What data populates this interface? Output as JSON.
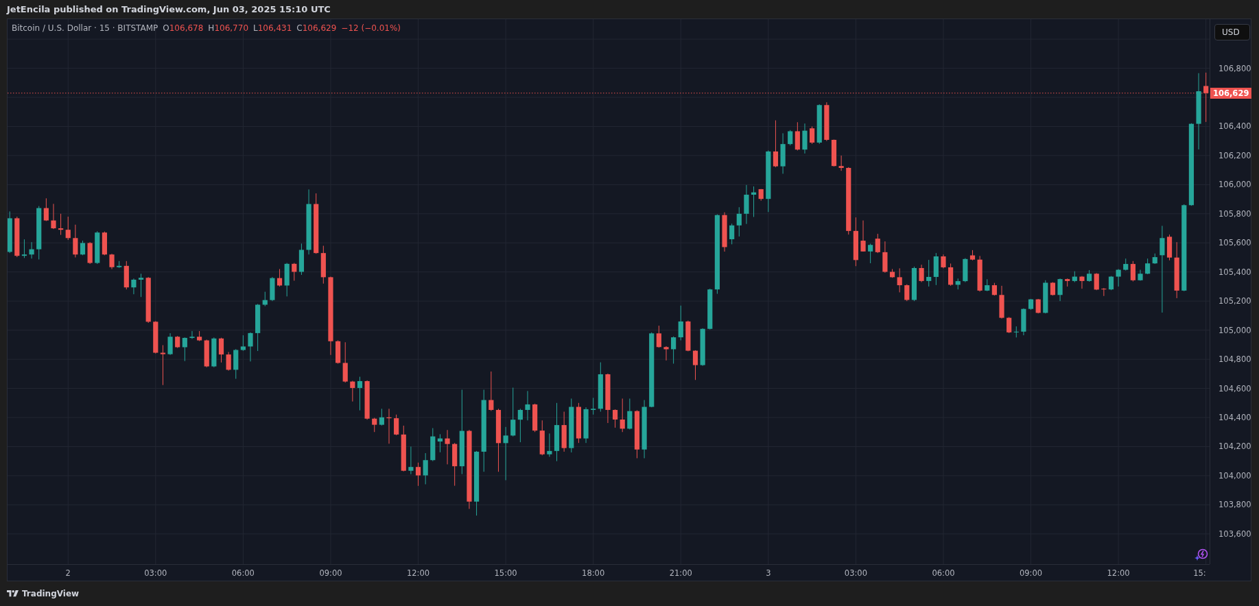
{
  "header": {
    "text": "JetEncila published on TradingView.com, Jun 03, 2025 15:10 UTC"
  },
  "chart": {
    "currency": "USD",
    "legend": {
      "symbol": "Bitcoin / U.S. Dollar · 15 · BITSTAMP",
      "ohlc": [
        {
          "label": "O",
          "value": "106,678"
        },
        {
          "label": "H",
          "value": "106,770"
        },
        {
          "label": "L",
          "value": "106,431"
        },
        {
          "label": "C",
          "value": "106,629"
        }
      ],
      "change": "−12 (−0.01%)"
    },
    "cut_time_label": "15:",
    "chart_data": {
      "type": "candlestick",
      "ylim": [
        103392,
        107137
      ],
      "grid": true,
      "ref_lines": [
        {
          "axis": "y",
          "value": 106629,
          "label": "106,629"
        }
      ],
      "yticks": [
        {
          "value": 103600,
          "label": "103,600"
        },
        {
          "value": 103800,
          "label": "103,800"
        },
        {
          "value": 104000,
          "label": "104,000"
        },
        {
          "value": 104200,
          "label": "104,200"
        },
        {
          "value": 104400,
          "label": "104,400"
        },
        {
          "value": 104600,
          "label": "104,600"
        },
        {
          "value": 104800,
          "label": "104,800"
        },
        {
          "value": 105000,
          "label": "105,000"
        },
        {
          "value": 105200,
          "label": "105,200"
        },
        {
          "value": 105400,
          "label": "105,400"
        },
        {
          "value": 105600,
          "label": "105,600"
        },
        {
          "value": 105800,
          "label": "105,800"
        },
        {
          "value": 106000,
          "label": "106,000"
        },
        {
          "value": 106200,
          "label": "106,200"
        },
        {
          "value": 106400,
          "label": "106,400"
        },
        {
          "value": 106800,
          "label": "106,800"
        }
      ],
      "categories": [
        null,
        null,
        null,
        null,
        null,
        null,
        null,
        null,
        "2",
        null,
        null,
        null,
        null,
        null,
        null,
        null,
        null,
        null,
        null,
        null,
        "03:00",
        null,
        null,
        null,
        null,
        null,
        null,
        null,
        null,
        null,
        null,
        null,
        "06:00",
        null,
        null,
        null,
        null,
        null,
        null,
        null,
        null,
        null,
        null,
        null,
        "09:00",
        null,
        null,
        null,
        null,
        null,
        null,
        null,
        null,
        null,
        null,
        null,
        "12:00",
        null,
        null,
        null,
        null,
        null,
        null,
        null,
        null,
        null,
        null,
        null,
        "15:00",
        null,
        null,
        null,
        null,
        null,
        null,
        null,
        null,
        null,
        null,
        null,
        "18:00",
        null,
        null,
        null,
        null,
        null,
        null,
        null,
        null,
        null,
        null,
        null,
        "21:00",
        null,
        null,
        null,
        null,
        null,
        null,
        null,
        null,
        null,
        null,
        null,
        "3",
        null,
        null,
        null,
        null,
        null,
        null,
        null,
        null,
        null,
        null,
        null,
        "03:00",
        null,
        null,
        null,
        null,
        null,
        null,
        null,
        null,
        null,
        null,
        null,
        "06:00",
        null,
        null,
        null,
        null,
        null,
        null,
        null,
        null,
        null,
        null,
        null,
        "09:00",
        null,
        null,
        null,
        null,
        null,
        null,
        null,
        null,
        null,
        null,
        null,
        "12:00",
        null,
        null,
        null,
        null,
        null,
        null,
        null,
        null,
        null,
        null,
        null,
        null
      ],
      "ohlc": [
        [
          105538,
          105816,
          105530,
          105769
        ],
        [
          105769,
          105780,
          105502,
          105511
        ],
        [
          105511,
          105624,
          105496,
          105520
        ],
        [
          105520,
          105605,
          105492,
          105556
        ],
        [
          105556,
          105853,
          105486,
          105839
        ],
        [
          105839,
          105906,
          105750,
          105754
        ],
        [
          105754,
          105868,
          105695,
          105700
        ],
        [
          105700,
          105800,
          105655,
          105690
        ],
        [
          105690,
          105780,
          105620,
          105633
        ],
        [
          105633,
          105725,
          105500,
          105520
        ],
        [
          105520,
          105615,
          105515,
          105599
        ],
        [
          105599,
          105605,
          105455,
          105462
        ],
        [
          105462,
          105680,
          105455,
          105671
        ],
        [
          105671,
          105678,
          105515,
          105520
        ],
        [
          105520,
          105525,
          105420,
          105433
        ],
        [
          105433,
          105475,
          105428,
          105442
        ],
        [
          105442,
          105475,
          105280,
          105294
        ],
        [
          105294,
          105355,
          105247,
          105347
        ],
        [
          105347,
          105388,
          105228,
          105360
        ],
        [
          105360,
          105365,
          105050,
          105058
        ],
        [
          105058,
          105062,
          104840,
          104845
        ],
        [
          104845,
          104897,
          104623,
          104835
        ],
        [
          104835,
          104979,
          104830,
          104955
        ],
        [
          104955,
          104960,
          104878,
          104883
        ],
        [
          104883,
          104950,
          104788,
          104947
        ],
        [
          104947,
          104994,
          104940,
          104955
        ],
        [
          104955,
          104994,
          104925,
          104930
        ],
        [
          104930,
          104935,
          104745,
          104751
        ],
        [
          104751,
          104950,
          104745,
          104943
        ],
        [
          104943,
          104948,
          104778,
          104833
        ],
        [
          104833,
          104850,
          104722,
          104728
        ],
        [
          104728,
          104870,
          104666,
          104864
        ],
        [
          104864,
          104965,
          104858,
          104888
        ],
        [
          104888,
          104985,
          104785,
          104980
        ],
        [
          104980,
          105180,
          104857,
          105175
        ],
        [
          105175,
          105264,
          105165,
          105207
        ],
        [
          105207,
          105365,
          105200,
          105358
        ],
        [
          105358,
          105420,
          105300,
          105307
        ],
        [
          105307,
          105462,
          105232,
          105456
        ],
        [
          105456,
          105462,
          105340,
          105401
        ],
        [
          105401,
          105595,
          105380,
          105552
        ],
        [
          105552,
          105967,
          105520,
          105867
        ],
        [
          105867,
          105940,
          105525,
          105530
        ],
        [
          105530,
          105580,
          105320,
          105364
        ],
        [
          105364,
          105368,
          104830,
          104924
        ],
        [
          104924,
          104930,
          104770,
          104775
        ],
        [
          104775,
          104917,
          104640,
          104647
        ],
        [
          104647,
          104652,
          104510,
          104603
        ],
        [
          104603,
          104680,
          104449,
          104650
        ],
        [
          104650,
          104655,
          104385,
          104392
        ],
        [
          104392,
          104398,
          104300,
          104350
        ],
        [
          104350,
          104460,
          104345,
          104401
        ],
        [
          104401,
          104460,
          104220,
          104395
        ],
        [
          104395,
          104420,
          104278,
          104283
        ],
        [
          104283,
          104344,
          104030,
          104034
        ],
        [
          104034,
          104200,
          104010,
          104060
        ],
        [
          104060,
          104090,
          103930,
          104002
        ],
        [
          104002,
          104155,
          103941,
          104107
        ],
        [
          104107,
          104327,
          104100,
          104270
        ],
        [
          104235,
          104285,
          104161,
          104256
        ],
        [
          104256,
          104314,
          104078,
          104218
        ],
        [
          104218,
          104225,
          103931,
          104065
        ],
        [
          104065,
          104591,
          104011,
          104308
        ],
        [
          104308,
          104315,
          103772,
          103822
        ],
        [
          103822,
          104170,
          103726,
          104165
        ],
        [
          104165,
          104591,
          104027,
          104520
        ],
        [
          104520,
          104716,
          104445,
          104452
        ],
        [
          104452,
          104460,
          104027,
          104224
        ],
        [
          104224,
          104335,
          103969,
          104276
        ],
        [
          104276,
          104605,
          104270,
          104385
        ],
        [
          104385,
          104460,
          104230,
          104452
        ],
        [
          104452,
          104582,
          104380,
          104490
        ],
        [
          104490,
          104495,
          104300,
          104310
        ],
        [
          104310,
          104380,
          104140,
          104147
        ],
        [
          104147,
          104290,
          104130,
          104170
        ],
        [
          104170,
          104500,
          104100,
          104348
        ],
        [
          104348,
          104440,
          104165,
          104190
        ],
        [
          104190,
          104530,
          104160,
          104473
        ],
        [
          104473,
          104500,
          104225,
          104256
        ],
        [
          104256,
          104470,
          104225,
          104457
        ],
        [
          104452,
          104535,
          104420,
          104460
        ],
        [
          104460,
          104779,
          104440,
          104697
        ],
        [
          104697,
          104702,
          104362,
          104452
        ],
        [
          104452,
          104456,
          104330,
          104386
        ],
        [
          104386,
          104530,
          104300,
          104323
        ],
        [
          104323,
          104530,
          104318,
          104444
        ],
        [
          104444,
          104450,
          104120,
          104180
        ],
        [
          104180,
          104520,
          104120,
          104473
        ],
        [
          104473,
          104985,
          104470,
          104978
        ],
        [
          104978,
          105031,
          104880,
          104884
        ],
        [
          104884,
          104890,
          104792,
          104869
        ],
        [
          104869,
          104957,
          104770,
          104951
        ],
        [
          104951,
          105169,
          104930,
          105060
        ],
        [
          105060,
          105066,
          104855,
          104859
        ],
        [
          104859,
          104862,
          104658,
          104760
        ],
        [
          104760,
          105013,
          104755,
          105009
        ],
        [
          105009,
          105285,
          105005,
          105280
        ],
        [
          105280,
          105796,
          105250,
          105791
        ],
        [
          105791,
          105810,
          105540,
          105571
        ],
        [
          105625,
          105732,
          105590,
          105720
        ],
        [
          105720,
          105845,
          105644,
          105800
        ],
        [
          105800,
          105998,
          105730,
          105931
        ],
        [
          105931,
          105988,
          105778,
          105947
        ],
        [
          105969,
          105970,
          105890,
          105902
        ],
        [
          105902,
          106235,
          105812,
          106228
        ],
        [
          106228,
          106442,
          106120,
          106126
        ],
        [
          106126,
          106353,
          106075,
          106279
        ],
        [
          106279,
          106375,
          106270,
          106367
        ],
        [
          106367,
          106429,
          106235,
          106241
        ],
        [
          106241,
          106420,
          106214,
          106371
        ],
        [
          106387,
          106400,
          106280,
          106289
        ],
        [
          106289,
          106552,
          106280,
          106547
        ],
        [
          106547,
          106566,
          106300,
          106308
        ],
        [
          106308,
          106310,
          106125,
          106128
        ],
        [
          106128,
          106200,
          106095,
          106115
        ],
        [
          106115,
          106120,
          105657,
          105682
        ],
        [
          105682,
          105775,
          105440,
          105482
        ],
        [
          105615,
          105754,
          105540,
          105541
        ],
        [
          105541,
          105594,
          105460,
          105586
        ],
        [
          105629,
          105662,
          105530,
          105536
        ],
        [
          105536,
          105610,
          105395,
          105401
        ],
        [
          105401,
          105420,
          105360,
          105364
        ],
        [
          105364,
          105425,
          105260,
          105309
        ],
        [
          105309,
          105315,
          105200,
          105208
        ],
        [
          105208,
          105437,
          105200,
          105427
        ],
        [
          105427,
          105450,
          105330,
          105338
        ],
        [
          105338,
          105483,
          105300,
          105366
        ],
        [
          105366,
          105530,
          105310,
          105507
        ],
        [
          105507,
          105520,
          105425,
          105432
        ],
        [
          105432,
          105458,
          105305,
          105312
        ],
        [
          105312,
          105355,
          105280,
          105337
        ],
        [
          105337,
          105495,
          105330,
          105489
        ],
        [
          105514,
          105550,
          105480,
          105485
        ],
        [
          105485,
          105510,
          105265,
          105272
        ],
        [
          105272,
          105350,
          105268,
          105309
        ],
        [
          105309,
          105325,
          105238,
          105242
        ],
        [
          105242,
          105305,
          105080,
          105085
        ],
        [
          105085,
          105090,
          104980,
          104985
        ],
        [
          104985,
          105026,
          104950,
          104990
        ],
        [
          104990,
          105150,
          104965,
          105146
        ],
        [
          105146,
          105215,
          105140,
          105212
        ],
        [
          105212,
          105215,
          105115,
          105119
        ],
        [
          105119,
          105343,
          105115,
          105326
        ],
        [
          105326,
          105330,
          105238,
          105242
        ],
        [
          105242,
          105355,
          105200,
          105351
        ],
        [
          105351,
          105355,
          105300,
          105338
        ],
        [
          105338,
          105405,
          105330,
          105368
        ],
        [
          105368,
          105372,
          105285,
          105338
        ],
        [
          105338,
          105413,
          105333,
          105388
        ],
        [
          105388,
          105392,
          105275,
          105279
        ],
        [
          105285,
          105290,
          105235,
          105280
        ],
        [
          105280,
          105372,
          105275,
          105368
        ],
        [
          105368,
          105420,
          105300,
          105415
        ],
        [
          105415,
          105492,
          105410,
          105455
        ],
        [
          105455,
          105475,
          105335,
          105343
        ],
        [
          105343,
          105415,
          105340,
          105388
        ],
        [
          105388,
          105492,
          105385,
          105459
        ],
        [
          105459,
          105527,
          105455,
          105502
        ],
        [
          105515,
          105717,
          105121,
          105633
        ],
        [
          105642,
          105657,
          105480,
          105499
        ],
        [
          105499,
          105605,
          105220,
          105272
        ],
        [
          105272,
          105865,
          105268,
          105859
        ],
        [
          105859,
          106422,
          105855,
          106418
        ],
        [
          106418,
          106766,
          106242,
          106642
        ],
        [
          106678,
          106770,
          106431,
          106629
        ]
      ]
    }
  },
  "footer": {
    "brand": "TradingView"
  }
}
